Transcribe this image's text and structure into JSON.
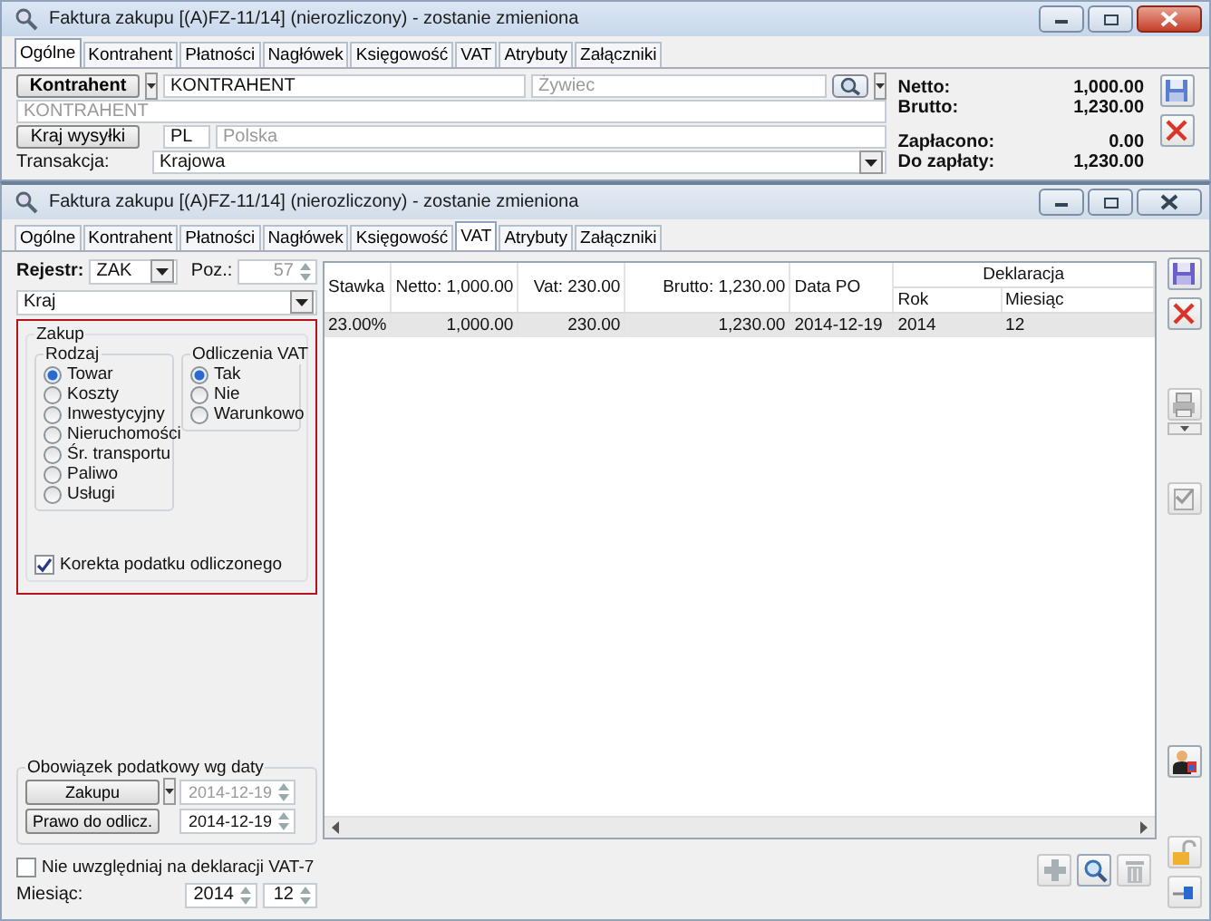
{
  "back_window": {
    "title": "Faktura zakupu [(A)FZ-11/14] (nierozliczony) - zostanie zmieniona",
    "tabs": [
      {
        "label": "Ogólne",
        "selected": true
      },
      {
        "label": "Kontrahent",
        "selected": false
      },
      {
        "label": "Płatności",
        "selected": false
      },
      {
        "label": "Nagłówek",
        "selected": false
      },
      {
        "label": "Księgowość",
        "selected": false
      },
      {
        "label": "VAT",
        "selected": false
      },
      {
        "label": "Atrybuty",
        "selected": false
      },
      {
        "label": "Załączniki",
        "selected": false
      }
    ],
    "contractor": {
      "button": "Kontrahent",
      "code": "KONTRAHENT",
      "city": "Żywiec",
      "name": "KONTRAHENT"
    },
    "country": {
      "button": "Kraj wysyłki",
      "code": "PL",
      "name": "Polska"
    },
    "transaction": {
      "label": "Transakcja:",
      "value": "Krajowa"
    },
    "totals": [
      {
        "rows": [
          {
            "label": "Netto:",
            "value": "1,000.00"
          },
          {
            "label": "Brutto:",
            "value": "1,230.00"
          }
        ]
      },
      {
        "rows": [
          {
            "label": "Zapłacono:",
            "value": "0.00"
          },
          {
            "label": "Do zapłaty:",
            "value": "1,230.00"
          }
        ]
      }
    ]
  },
  "front_window": {
    "title": "Faktura zakupu [(A)FZ-11/14] (nierozliczony) - zostanie zmieniona",
    "tabs": [
      {
        "label": "Ogólne",
        "selected": false
      },
      {
        "label": "Kontrahent",
        "selected": false
      },
      {
        "label": "Płatności",
        "selected": false
      },
      {
        "label": "Nagłówek",
        "selected": false
      },
      {
        "label": "Księgowość",
        "selected": false
      },
      {
        "label": "VAT",
        "selected": true
      },
      {
        "label": "Atrybuty",
        "selected": false
      },
      {
        "label": "Załączniki",
        "selected": false
      }
    ],
    "register": {
      "label": "Rejestr:",
      "value": "ZAK"
    },
    "position": {
      "label": "Poz.:",
      "value": "57",
      "disabled": true
    },
    "country_select": {
      "value": "Kraj"
    },
    "purchase": {
      "title": "Zakup",
      "kind_group": {
        "title": "Rodzaj",
        "options": [
          {
            "label": "Towar",
            "selected": true
          },
          {
            "label": "Koszty",
            "selected": false
          },
          {
            "label": "Inwestycyjny",
            "selected": false
          },
          {
            "label": "Nieruchomości",
            "selected": false
          },
          {
            "label": "Śr. transportu",
            "selected": false
          },
          {
            "label": "Paliwo",
            "selected": false
          },
          {
            "label": "Usługi",
            "selected": false
          }
        ]
      },
      "deduction_group": {
        "title": "Odliczenia VAT",
        "options": [
          {
            "label": "Tak",
            "selected": true
          },
          {
            "label": "Nie",
            "selected": false
          },
          {
            "label": "Warunkowo",
            "selected": false
          }
        ]
      },
      "correction": {
        "label": "Korekta podatku odliczonego",
        "checked": true
      }
    },
    "tax_dates": {
      "title": "Obowiązek podatkowy wg daty",
      "rows": [
        {
          "button": "Zakupu",
          "date": "2014-12-19",
          "disabled": true
        },
        {
          "button": "Prawo do odlicz.",
          "date": "2014-12-19",
          "disabled": false
        }
      ]
    },
    "exclude": {
      "label": "Nie uwzględniaj na deklaracji VAT-7",
      "checked": false
    },
    "month": {
      "label": "Miesiąc:",
      "year": "2014",
      "month": "12"
    },
    "vat_table": {
      "group_header": "Deklaracja",
      "columns": [
        "Stawka",
        "Netto: 1,000.00",
        "Vat: 230.00",
        "Brutto: 1,230.00",
        "Data PO",
        "Rok",
        "Miesiąc"
      ],
      "rows": [
        {
          "cells": [
            "23.00%",
            "1,000.00",
            "230.00",
            "1,230.00",
            "2014-12-19",
            "2014",
            "12"
          ],
          "selected": true
        }
      ]
    }
  }
}
